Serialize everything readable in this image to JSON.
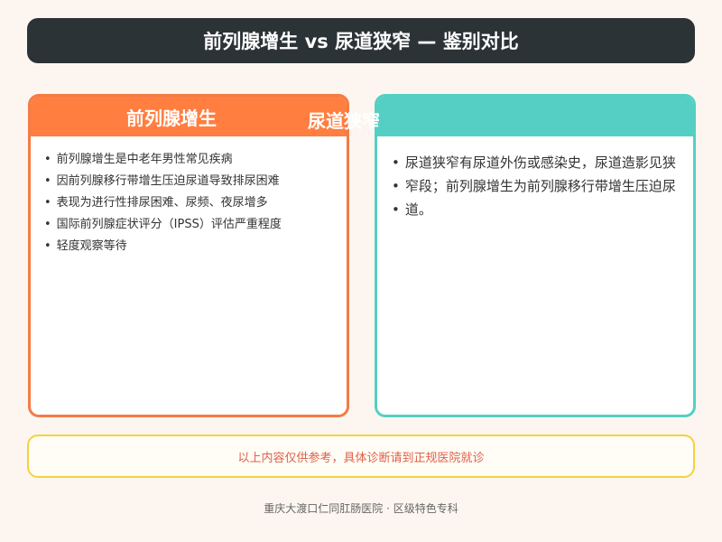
{
  "title": "前列腺增生 vs 尿道狭窄 — 鉴别对比",
  "left_panel": {
    "heading": "前列腺增生",
    "points": [
      "前列腺增生是中老年男性常见疾病",
      "因前列腺移行带增生压迫尿道导致排尿困难",
      "表现为进行性排尿困难、尿频、夜尿增多",
      "国际前列腺症状评分（IPSS）评估严重程度",
      "轻度观察等待"
    ]
  },
  "right_panel": {
    "heading": "尿道狭窄",
    "points": [
      "尿道狭窄有尿道外伤或感染史，尿道造影见狭",
      "窄段；前列腺增生为前列腺移行带增生压迫尿",
      "道。"
    ]
  },
  "bullet_glyph": "•",
  "notice": "以上内容仅供参考，具体诊断请到正规医院就诊",
  "footer": "重庆大渡口仁同肛肠医院 · 区级特色专科",
  "colors": {
    "title_bg": "#2c3336",
    "left_accent": "#ff7e40",
    "right_accent": "#55cfc4",
    "notice_border": "#f5d13d",
    "notice_text": "#e0604a"
  }
}
